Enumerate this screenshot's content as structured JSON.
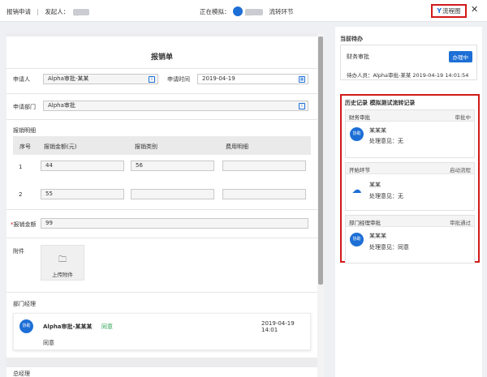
{
  "header": {
    "title": "报销申请",
    "separator": "|",
    "initiator_label": "发起人：",
    "initiator_name": "方xx",
    "simulating_label": "正在模拟：",
    "simulating_name": "某xx",
    "flow_link": "流转环节",
    "flowchart_button": "流程图",
    "close_glyph": "✕"
  },
  "form": {
    "title": "报销单",
    "applicant_label": "申请人",
    "applicant_value": "Alpha审批-某某",
    "apply_time_label": "申请时间",
    "apply_time_value": "2019-04-19",
    "dept_label": "申请部门",
    "dept_value": "Alpha审批",
    "detail_label": "报销明细",
    "detail_columns": [
      "序号",
      "报销金额(元)",
      "报销类别",
      "费用明细"
    ],
    "detail_rows": [
      {
        "no": "1",
        "amount": "44",
        "category": "56",
        "detail": ""
      },
      {
        "no": "2",
        "amount": "55",
        "category": "",
        "detail": ""
      }
    ],
    "total_label": "报销金额",
    "total_value": "99",
    "attachment_label": "附件",
    "upload_label": "上传附件",
    "dept_manager_label": "部门经理",
    "approval": {
      "avatar_text": "协助",
      "name": "Alpha审批-某某某",
      "status": "同意",
      "time": "2019-04-19 14:01",
      "comment": "同意"
    },
    "gm_label": "总经理"
  },
  "pending": {
    "title": "当前待办",
    "step": "财务审批",
    "status_badge": "办理中",
    "handler_text": "待办人员：Alpha审批-某某 2019-04-19 14:01:54"
  },
  "history": {
    "title": "历史记录",
    "subtitle": "模拟测试流转记录",
    "records": [
      {
        "step": "财务审批",
        "status": "审批中",
        "avatar_text": "协助",
        "person": "某某某",
        "opinion_label": "处理意见：",
        "opinion": "无"
      },
      {
        "step": "开始环节",
        "status": "启动流程",
        "avatar_text": "",
        "person": "某某",
        "opinion_label": "处理意见：",
        "opinion": "无"
      },
      {
        "step": "部门经理审批",
        "status": "审批通过",
        "avatar_text": "协助",
        "person": "某某某",
        "opinion_label": "处理意见：",
        "opinion": "同意"
      }
    ]
  },
  "colors": {
    "accent": "#1d6fd6",
    "highlight_border": "#d11a1a",
    "agree": "#2aa150"
  }
}
